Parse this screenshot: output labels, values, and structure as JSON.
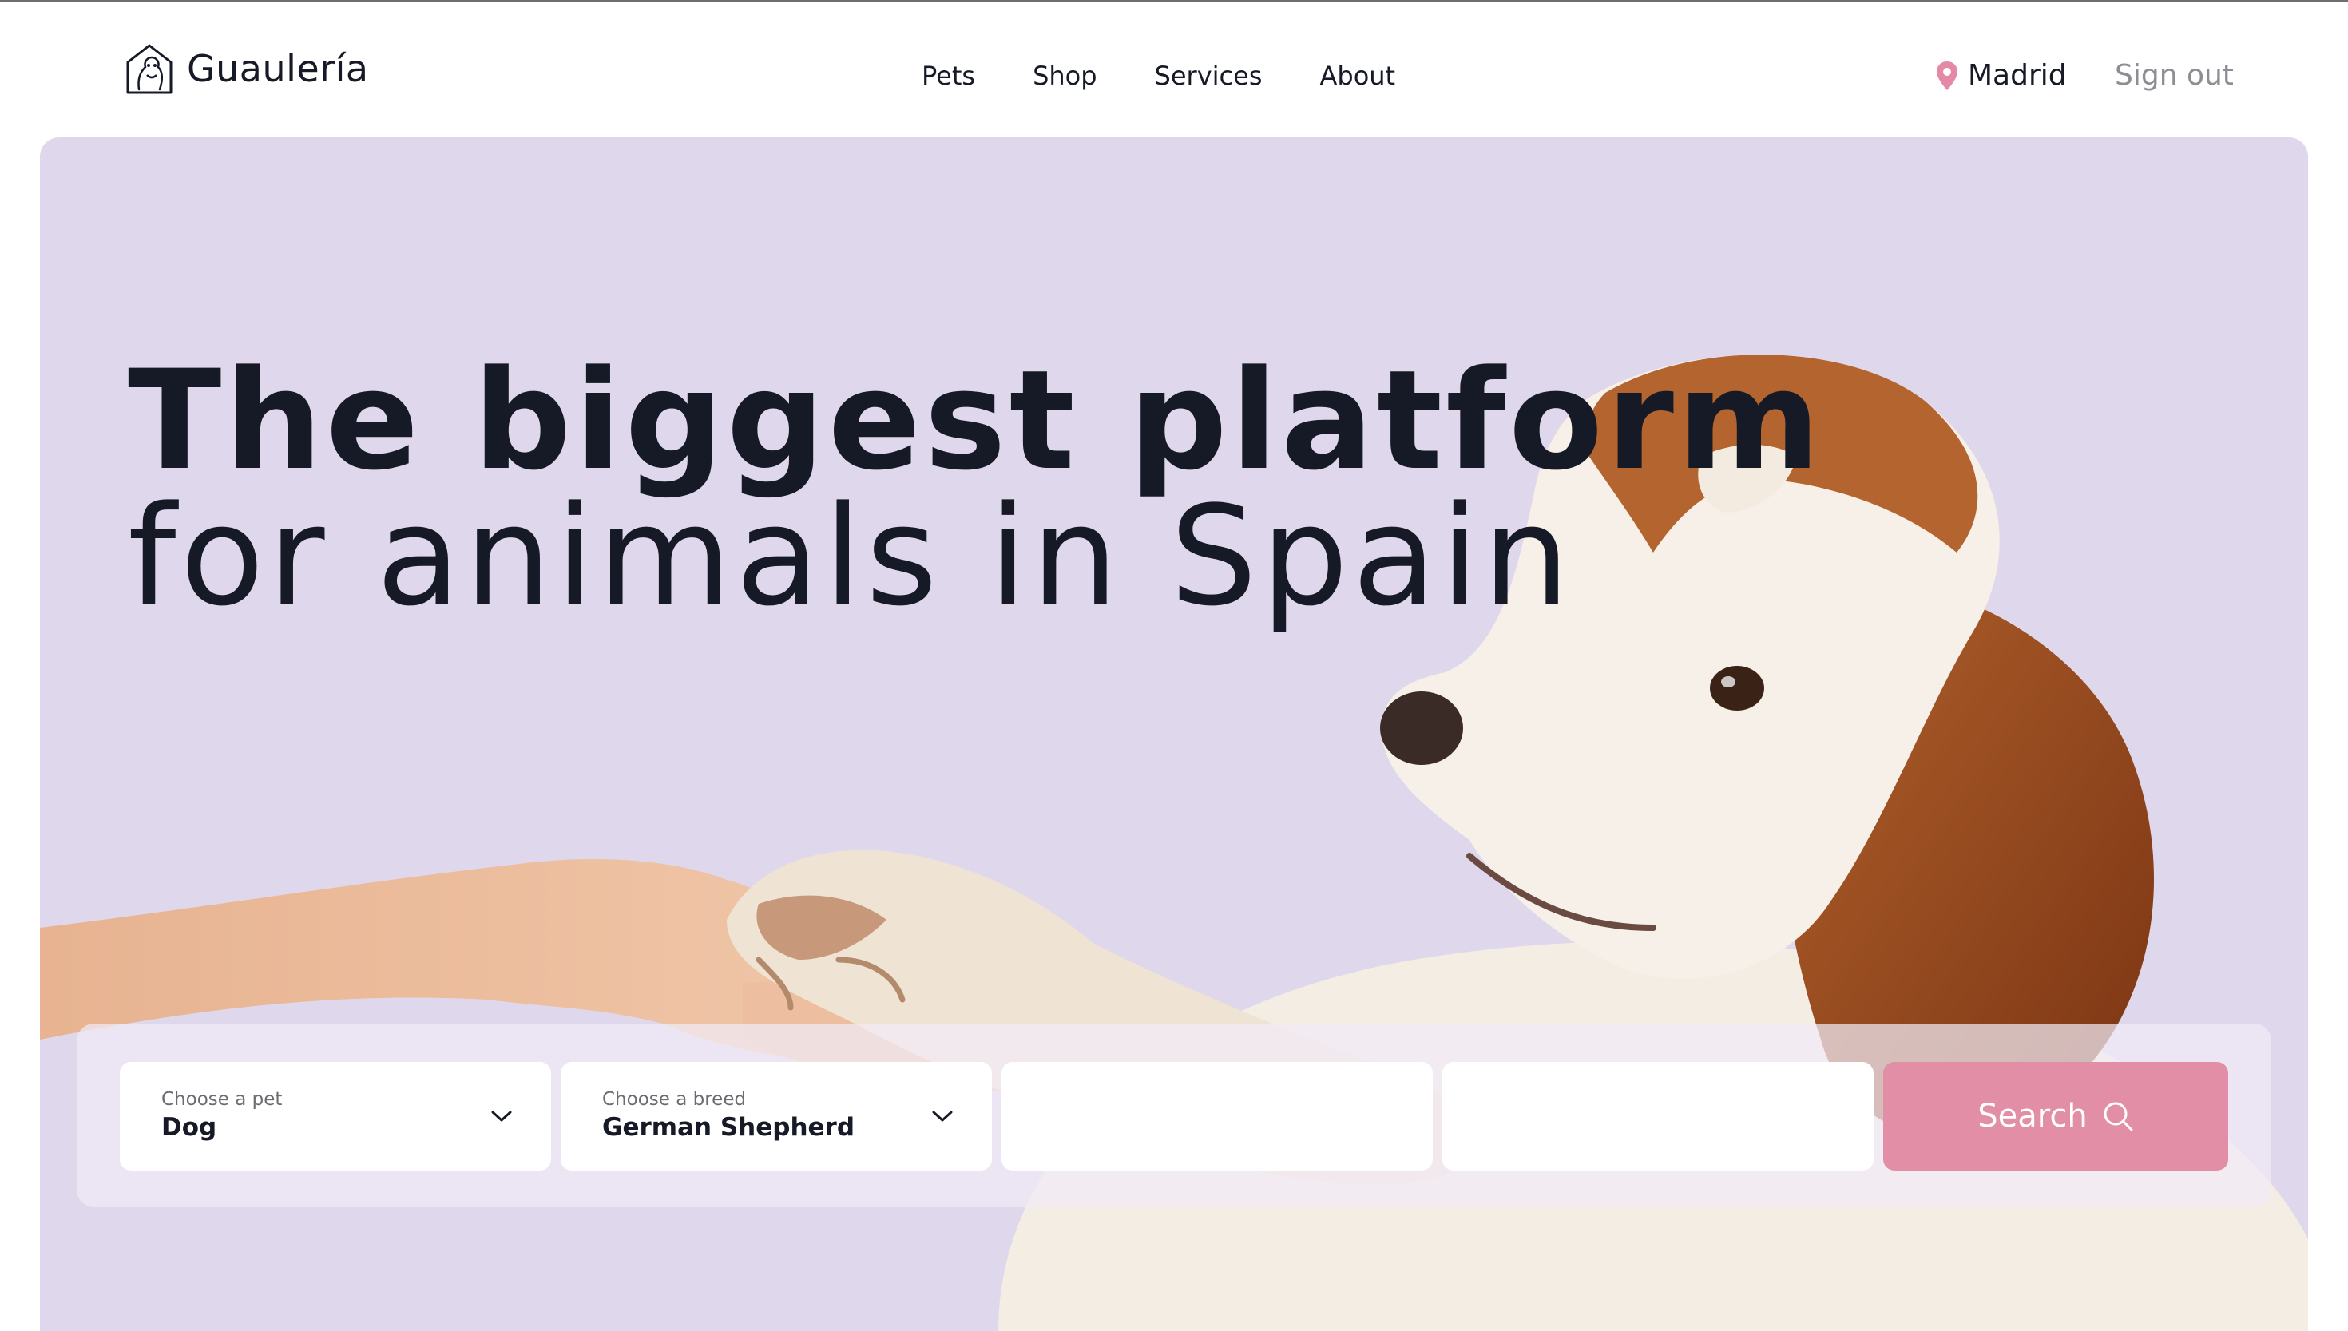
{
  "brand": {
    "name": "Guaulería",
    "logo_icon": "house-dog-icon"
  },
  "nav": [
    {
      "label": "Pets"
    },
    {
      "label": "Shop"
    },
    {
      "label": "Services"
    },
    {
      "label": "About"
    }
  ],
  "location": {
    "label": "Madrid",
    "icon": "map-pin-icon",
    "icon_color": "#e58aa6"
  },
  "signout": {
    "label": "Sign out"
  },
  "hero": {
    "title_bold": "The biggest platform",
    "title_regular": "for animals in Spain",
    "background": "#dfd8ec",
    "image_subject": "dog giving paw to human hand"
  },
  "search": {
    "pet": {
      "label": "Choose a pet",
      "value": "Dog"
    },
    "breed": {
      "label": "Choose a breed",
      "value": "German Shepherd"
    },
    "field3": {
      "value": ""
    },
    "field4": {
      "value": ""
    },
    "button": {
      "label": "Search",
      "icon": "search-icon",
      "color": "#e28ea6"
    }
  }
}
